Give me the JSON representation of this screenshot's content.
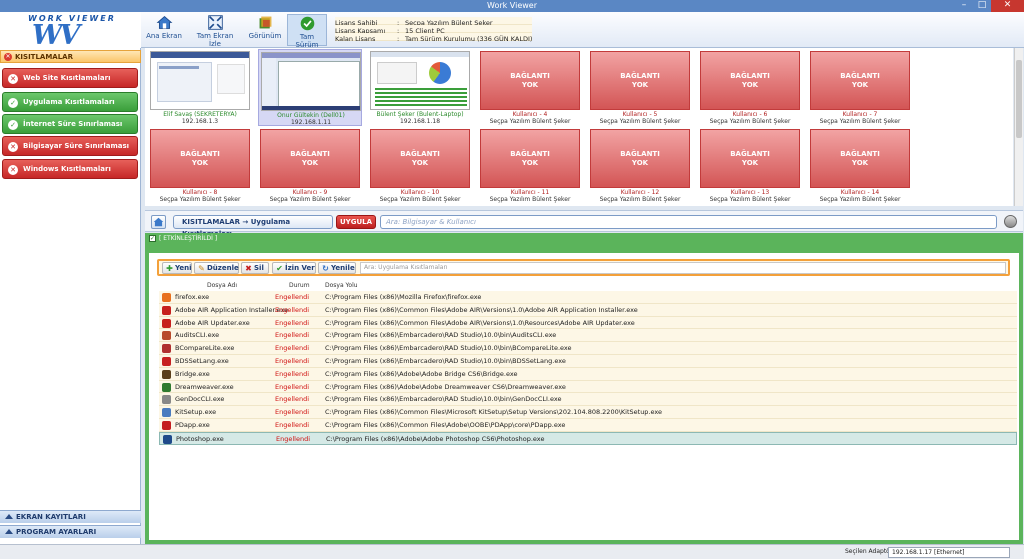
{
  "window": {
    "title": "Work Viewer",
    "min": "–",
    "max": "□",
    "close": "✕"
  },
  "logo": {
    "top_text": "WORK VIEWER",
    "mark": "WV"
  },
  "toolbar": {
    "home": "Ana Ekran",
    "fullscreen": "Tam Ekran İzle",
    "view": "Görünüm",
    "full_version": "Tam Sürüm"
  },
  "license": [
    {
      "k": "Lisans Sahibi",
      "v": "Seçpa Yazılım Bülent Şeker"
    },
    {
      "k": "Lisans Kapsamı",
      "v": "15 Client PC"
    },
    {
      "k": "Kalan Lisans Süresi",
      "v": "Tam Sürüm Kurulumu (336 GÜN KALDI)"
    }
  ],
  "sidebar": {
    "header": "KISITLAMALAR",
    "items": [
      {
        "label": "Web Site Kısıtlamaları",
        "color": "red",
        "mark": "✕"
      },
      {
        "label": "Uygulama Kısıtlamaları",
        "color": "green",
        "mark": "✓"
      },
      {
        "label": "İnternet Süre Sınırlaması",
        "color": "green",
        "mark": "✓"
      },
      {
        "label": "Bilgisayar Süre Sınırlaması",
        "color": "red",
        "mark": "✕"
      },
      {
        "label": "Windows Kısıtlamaları",
        "color": "red",
        "mark": "✕"
      }
    ],
    "footer1": "EKRAN KAYITLARI",
    "footer2": "PROGRAM AYARLARI"
  },
  "clients": [
    {
      "name": "Elif Savaş (SEKRETERYA)",
      "ip": "192.168.1.3",
      "status": "online",
      "screen": "web"
    },
    {
      "name": "Onur Gültekin (Dell01)",
      "ip": "192.168.1.11",
      "status": "online",
      "screen": "desktop",
      "selected": true
    },
    {
      "name": "Bülent Şeker (Bulent-Laptop)",
      "ip": "192.168.1.18",
      "status": "online",
      "screen": "report"
    },
    {
      "name": "Kullanıcı - 4",
      "ip": "Seçpa Yazılım Bülent Şeker",
      "status": "offline"
    },
    {
      "name": "Kullanıcı - 5",
      "ip": "Seçpa Yazılım Bülent Şeker",
      "status": "offline"
    },
    {
      "name": "Kullanıcı - 6",
      "ip": "Seçpa Yazılım Bülent Şeker",
      "status": "offline"
    },
    {
      "name": "Kullanıcı - 7",
      "ip": "Seçpa Yazılım Bülent Şeker",
      "status": "offline"
    },
    {
      "name": "Kullanıcı - 8",
      "ip": "Seçpa Yazılım Bülent Şeker",
      "status": "offline"
    },
    {
      "name": "Kullanıcı - 9",
      "ip": "Seçpa Yazılım Bülent Şeker",
      "status": "offline"
    },
    {
      "name": "Kullanıcı - 10",
      "ip": "Seçpa Yazılım Bülent Şeker",
      "status": "offline"
    },
    {
      "name": "Kullanıcı - 11",
      "ip": "Seçpa Yazılım Bülent Şeker",
      "status": "offline"
    },
    {
      "name": "Kullanıcı - 12",
      "ip": "Seçpa Yazılım Bülent Şeker",
      "status": "offline"
    },
    {
      "name": "Kullanıcı - 13",
      "ip": "Seçpa Yazılım Bülent Şeker",
      "status": "offline"
    },
    {
      "name": "Kullanıcı - 14",
      "ip": "Seçpa Yazılım Bülent Şeker",
      "status": "offline"
    }
  ],
  "offline_text": [
    "BAĞLANTI",
    "YOK"
  ],
  "breadcrumb": {
    "part1": "KISITLAMALAR",
    "arrow": "→",
    "part2": "Uygulama Kısıtlamaları"
  },
  "apply_label": "UYGULA",
  "search_placeholder": "Ara: Bilgisayar & Kullanıcı",
  "enable_label": "[ ETKİNLEŞTİRİLDİ ]",
  "enable_check": "✓",
  "buttons": {
    "new": "Yeni",
    "edit": "Düzenle",
    "delete": "Sil",
    "allow": "İzin Ver",
    "refresh": "Yenile"
  },
  "table_search_placeholder": "Ara: Uygulama Kısıtlamaları",
  "columns": {
    "name": "Dosya Adı",
    "status": "Durum",
    "path": "Dosya Yolu"
  },
  "rows": [
    {
      "name": "firefox.exe",
      "status": "Engellendi",
      "path": "C:\\Program Files (x86)\\Mozilla Firefox\\firefox.exe",
      "icon": "#e8701e"
    },
    {
      "name": "Adobe AIR Application Installer.exe",
      "status": "Engellendi",
      "path": "C:\\Program Files (x86)\\Common Files\\Adobe AIR\\Versions\\1.0\\Adobe AIR Application Installer.exe",
      "icon": "#c7201d"
    },
    {
      "name": "Adobe AIR Updater.exe",
      "status": "Engellendi",
      "path": "C:\\Program Files (x86)\\Common Files\\Adobe AIR\\Versions\\1.0\\Resources\\Adobe AIR Updater.exe",
      "icon": "#c7201d"
    },
    {
      "name": "AuditsCLI.exe",
      "status": "Engellendi",
      "path": "C:\\Program Files (x86)\\Embarcadero\\RAD Studio\\10.0\\bin\\AuditsCLI.exe",
      "icon": "#b84a2a"
    },
    {
      "name": "BCompareLite.exe",
      "status": "Engellendi",
      "path": "C:\\Program Files (x86)\\Embarcadero\\RAD Studio\\10.0\\bin\\BCompareLite.exe",
      "icon": "#b03030"
    },
    {
      "name": "BDSSetLang.exe",
      "status": "Engellendi",
      "path": "C:\\Program Files (x86)\\Embarcadero\\RAD Studio\\10.0\\bin\\BDSSetLang.exe",
      "icon": "#c62020"
    },
    {
      "name": "Bridge.exe",
      "status": "Engellendi",
      "path": "C:\\Program Files (x86)\\Adobe\\Adobe Bridge CS6\\Bridge.exe",
      "icon": "#5a3e1a"
    },
    {
      "name": "Dreamweaver.exe",
      "status": "Engellendi",
      "path": "C:\\Program Files (x86)\\Adobe\\Adobe Dreamweaver CS6\\Dreamweaver.exe",
      "icon": "#2f7a2f"
    },
    {
      "name": "GenDocCLI.exe",
      "status": "Engellendi",
      "path": "C:\\Program Files (x86)\\Embarcadero\\RAD Studio\\10.0\\bin\\GenDocCLI.exe",
      "icon": "#888888"
    },
    {
      "name": "KitSetup.exe",
      "status": "Engellendi",
      "path": "C:\\Program Files (x86)\\Common Files\\Microsoft KitSetup\\Setup Versions\\202.104.808.2200\\KitSetup.exe",
      "icon": "#4a7bbf"
    },
    {
      "name": "PDapp.exe",
      "status": "Engellendi",
      "path": "C:\\Program Files (x86)\\Common Files\\Adobe\\OOBE\\PDApp\\core\\PDapp.exe",
      "icon": "#c41e1e"
    },
    {
      "name": "Photoshop.exe",
      "status": "Engellendi",
      "path": "C:\\Program Files (x86)\\Adobe\\Adobe Photoshop CS6\\Photoshop.exe",
      "icon": "#1f4a8a",
      "selected": true
    }
  ],
  "status": {
    "adapter_label": "Seçilen Adaptör:",
    "adapter_value": "192.168.1.17  [Ethernet]"
  }
}
